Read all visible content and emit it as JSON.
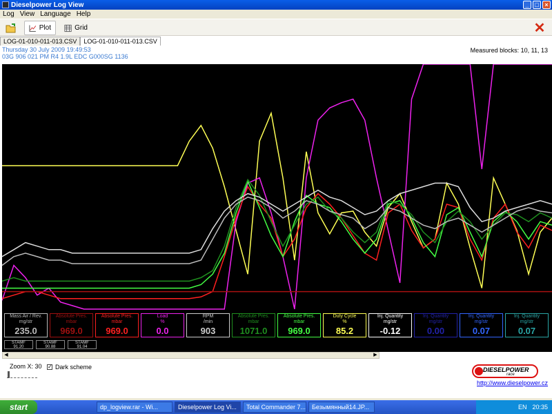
{
  "window": {
    "title": "Dieselpower Log View"
  },
  "menu": [
    "Log",
    "View",
    "Language",
    "Help"
  ],
  "toolbar": {
    "plot_label": "Plot",
    "grid_label": "Grid",
    "close_symbol": "✕"
  },
  "tabs": [
    "LOG-01-010-011-013.CSV",
    "LOG-01-010-011-013.CSV"
  ],
  "info": {
    "date": "Thursday 30 July 2009 19:49:53",
    "ecu": "03G 906 021 PM  R4 1.9L EDC G000SG  1136",
    "measured": "Measured blocks: 10, 11, 13"
  },
  "panels": [
    {
      "title": "Mass Air / Rev.",
      "unit": "mg/str",
      "value": "235.0",
      "color": "#bbbbbb"
    },
    {
      "title": "Absolute Pres.",
      "unit": "mbar",
      "value": "969.0",
      "color": "#a01010"
    },
    {
      "title": "Absolute Pres.",
      "unit": "mbar",
      "value": "969.0",
      "color": "#ff2020"
    },
    {
      "title": "Load",
      "unit": "%",
      "value": "0.0",
      "color": "#ee22ee"
    },
    {
      "title": "RPM",
      "unit": "/min",
      "value": "903",
      "color": "#cccccc"
    },
    {
      "title": "Absolute Pres.",
      "unit": "mbar",
      "value": "1071.0",
      "color": "#1f8f1f"
    },
    {
      "title": "Absolute Pres.",
      "unit": "mbar",
      "value": "969.0",
      "color": "#44ff44"
    },
    {
      "title": "Duty Cycle",
      "unit": "%",
      "value": "85.2",
      "color": "#ffff55"
    },
    {
      "title": "Inj. Quantity",
      "unit": "mg/str",
      "value": "-0.12",
      "color": "#ffffff"
    },
    {
      "title": "Inj. Quantity",
      "unit": "mg/str",
      "value": "0.00",
      "color": "#2222aa"
    },
    {
      "title": "Inj. Quantity",
      "unit": "mg/str",
      "value": "0.07",
      "color": "#3366ff"
    },
    {
      "title": "Inj. Quantity",
      "unit": "mg/str",
      "value": "0.07",
      "color": "#2aa6a6"
    }
  ],
  "stamf": [
    {
      "label": "STAMF",
      "value": "91.20"
    },
    {
      "label": "STAMF",
      "value": "90.88"
    },
    {
      "label": "STAMF",
      "value": "91.04"
    }
  ],
  "zoom": {
    "label": "Zoom X: 30"
  },
  "dark_scheme": {
    "label": "Dark scheme",
    "checked": true
  },
  "logo": {
    "line1": "DIESELPOWER",
    "line2": "race engineering"
  },
  "link": "http://www.dieselpower.cz",
  "taskbar": {
    "start": "start",
    "tasks": [
      "dp_logview.rar - Wi...",
      "Dieselpower Log Vi...",
      "Total Commander 7...",
      "Безымянный14.JP..."
    ],
    "lang": "EN",
    "clock": "20:35"
  },
  "chart_data": {
    "type": "line",
    "series": [
      {
        "color": "#ffff55",
        "values": [
          82,
          82,
          82,
          82,
          82,
          82,
          82,
          82,
          82,
          82,
          82,
          82,
          82,
          82,
          82,
          82,
          96,
          105,
          92,
          70,
          45,
          20,
          96,
          112,
          75,
          28,
          90,
          55,
          43,
          55,
          56,
          44,
          36,
          58,
          66,
          50,
          35,
          40,
          72,
          60,
          35,
          12,
          75,
          60,
          45,
          20,
          44,
          52
        ]
      },
      {
        "color": "#ee22ee",
        "values": [
          5,
          25,
          18,
          8,
          12,
          4,
          2,
          0,
          0,
          0,
          0,
          0,
          0,
          0,
          0,
          0,
          0,
          0,
          0,
          0,
          50,
          72,
          75,
          55,
          30,
          0,
          75,
          108,
          115,
          118,
          120,
          108,
          75,
          45,
          15,
          120,
          140,
          140,
          140,
          140,
          140,
          80,
          140,
          140,
          140,
          140,
          140,
          140
        ]
      },
      {
        "color": "#ff2020",
        "values": [
          6,
          8,
          10,
          10,
          8,
          6,
          6,
          6,
          6,
          6,
          6,
          6,
          6,
          6,
          6,
          6,
          6,
          7,
          10,
          30,
          52,
          70,
          60,
          52,
          30,
          40,
          58,
          66,
          60,
          52,
          42,
          32,
          28,
          55,
          60,
          45,
          35,
          40,
          60,
          58,
          40,
          28,
          52,
          60,
          44,
          35,
          48,
          45
        ]
      },
      {
        "color": "#44ff44",
        "values": [
          12,
          12,
          12,
          12,
          12,
          12,
          12,
          12,
          12,
          12,
          12,
          12,
          12,
          12,
          12,
          12,
          12,
          14,
          20,
          32,
          55,
          73,
          58,
          42,
          30,
          50,
          65,
          60,
          58,
          50,
          40,
          32,
          40,
          60,
          62,
          52,
          38,
          30,
          54,
          58,
          44,
          30,
          50,
          56,
          50,
          40,
          50,
          48
        ]
      },
      {
        "color": "#1f8f1f",
        "values": [
          16,
          18,
          16,
          16,
          16,
          16,
          16,
          16,
          16,
          16,
          16,
          16,
          16,
          16,
          16,
          16,
          16,
          18,
          22,
          36,
          58,
          74,
          65,
          50,
          36,
          48,
          60,
          64,
          56,
          52,
          44,
          38,
          44,
          62,
          60,
          54,
          44,
          38,
          50,
          56,
          50,
          40,
          48,
          55,
          54,
          50,
          55,
          52
        ]
      },
      {
        "color": "#bbbbbb",
        "values": [
          25,
          30,
          32,
          30,
          28,
          28,
          26,
          26,
          26,
          26,
          26,
          26,
          26,
          26,
          26,
          26,
          26,
          28,
          40,
          52,
          60,
          64,
          62,
          58,
          52,
          56,
          62,
          60,
          56,
          54,
          52,
          46,
          50,
          58,
          56,
          52,
          48,
          46,
          50,
          52,
          48,
          44,
          48,
          52,
          56,
          58,
          56,
          55
        ]
      },
      {
        "color": "#dddddd",
        "values": [
          30,
          34,
          38,
          36,
          34,
          34,
          32,
          32,
          32,
          32,
          32,
          32,
          32,
          32,
          32,
          32,
          32,
          34,
          46,
          56,
          62,
          66,
          64,
          60,
          56,
          60,
          64,
          68,
          64,
          62,
          58,
          54,
          56,
          62,
          66,
          68,
          70,
          72,
          72,
          70,
          58,
          50,
          52,
          56,
          58,
          60,
          62,
          60
        ]
      },
      {
        "color": "#aa1010",
        "values": [
          10,
          10,
          10,
          10,
          10,
          10,
          10,
          10,
          10,
          10,
          10,
          10,
          10,
          10,
          10,
          10,
          10,
          10,
          10,
          10,
          10,
          10,
          10,
          10,
          10,
          10,
          10,
          10,
          10,
          10,
          10,
          10,
          10,
          10,
          10,
          10,
          10,
          10,
          10,
          10,
          10,
          10,
          10,
          10,
          10,
          10,
          10,
          10
        ]
      }
    ],
    "ylim": [
      0,
      140
    ]
  }
}
